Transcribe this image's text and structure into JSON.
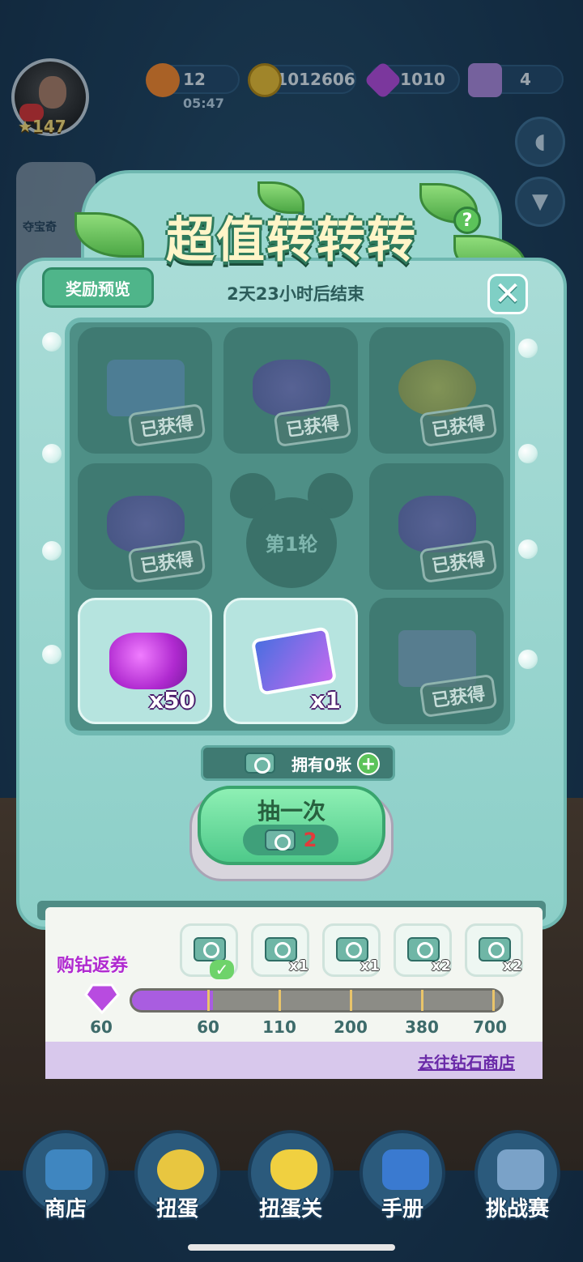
{
  "player": {
    "level": "147",
    "avatar": "boxing-avatar"
  },
  "resources": {
    "energy": "12",
    "energy_timer": "05:47",
    "coins": "1012606",
    "gems": "1010",
    "crowns": "4"
  },
  "side_panel": {
    "item_label": "夺宝奇"
  },
  "event": {
    "title": "超值转转转",
    "help_label": "?",
    "preview_label": "奖励预览",
    "countdown": "2天23小时后结束",
    "close_label": "✕"
  },
  "grid": {
    "round_label": "第1轮",
    "obtained_label": "已获得",
    "cells": [
      {
        "icon": "sticker-card-icon",
        "obtained": true,
        "qty": ""
      },
      {
        "icon": "gems-pile-icon",
        "obtained": true,
        "qty": ""
      },
      {
        "icon": "coins-pile-icon",
        "obtained": true,
        "qty": ""
      },
      {
        "icon": "gems-pile-icon",
        "obtained": true,
        "qty": ""
      },
      {
        "icon": "gems-pile-icon",
        "obtained": true,
        "qty": ""
      },
      {
        "icon": "gems-pile-icon",
        "obtained": false,
        "qty": "x50"
      },
      {
        "icon": "sticker-card-icon",
        "obtained": false,
        "qty": "x1"
      },
      {
        "icon": "gift-box-icon",
        "obtained": true,
        "qty": ""
      }
    ]
  },
  "tickets": {
    "owned_label": "拥有0张",
    "plus_label": "+"
  },
  "draw": {
    "label": "抽一次",
    "cost": "2"
  },
  "progress": {
    "title": "购钻返券",
    "current": "60",
    "fill_fraction": 0.22,
    "milestones": [
      {
        "threshold": "60",
        "reward": "",
        "claimed": true
      },
      {
        "threshold": "110",
        "reward": "x1",
        "claimed": false
      },
      {
        "threshold": "200",
        "reward": "x1",
        "claimed": false
      },
      {
        "threshold": "380",
        "reward": "x2",
        "claimed": false
      },
      {
        "threshold": "700",
        "reward": "x2",
        "claimed": false
      }
    ],
    "check_label": "✓",
    "shop_link": "去往钻石商店"
  },
  "nav": [
    "商店",
    "扭蛋",
    "扭蛋关",
    "手册",
    "挑战赛"
  ],
  "colors": {
    "accent": "#8ccfc8",
    "gem": "#b84be0",
    "button": "#4ec98a"
  }
}
